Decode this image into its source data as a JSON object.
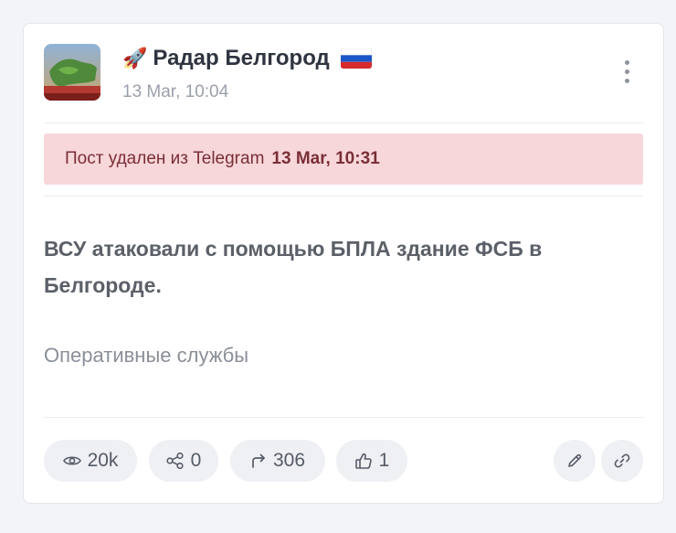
{
  "channel": {
    "emoji": "🚀",
    "name": "Радар Белгород",
    "flag_icon": "russia-flag-icon",
    "date": "13 Mar, 10:04"
  },
  "alert": {
    "text": "Пост удален из Telegram",
    "date": "13 Mar, 10:31"
  },
  "post": {
    "text": "ВСУ атаковали с помощью БПЛА здание ФСБ в Белгороде.",
    "source": "Оперативные службы"
  },
  "stats": {
    "views": "20k",
    "shares": "0",
    "forwards": "306",
    "likes": "1"
  },
  "icons": {
    "views": "eye-icon",
    "shares": "share-nodes-icon",
    "forwards": "forward-arrow-icon",
    "likes": "thumbs-up-icon",
    "edit": "pencil-icon",
    "link": "link-icon",
    "menu": "kebab-menu-icon"
  },
  "colors": {
    "alert_background": "#f8d7da",
    "alert_text": "#7a2e36",
    "chip_background": "#eef0f4"
  }
}
